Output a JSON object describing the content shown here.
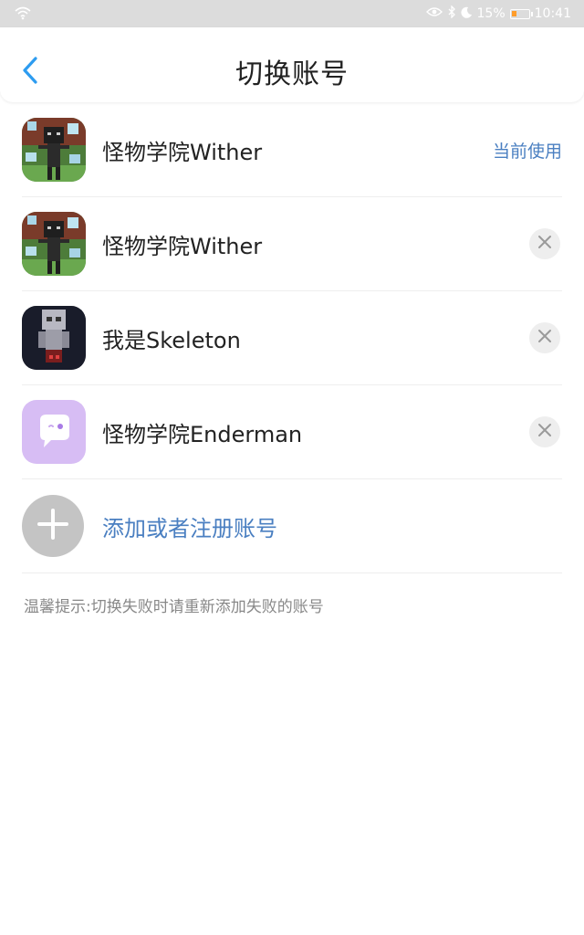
{
  "status_bar": {
    "battery_percent": "15%",
    "time": "10:41",
    "icons": [
      "wifi-icon",
      "eye-icon",
      "bluetooth-icon",
      "moon-icon",
      "battery-icon"
    ]
  },
  "header": {
    "title": "切换账号",
    "back_icon": "chevron-left-icon"
  },
  "accounts": [
    {
      "name": "怪物学院Wither",
      "status": "当前使用",
      "avatar": "wither"
    },
    {
      "name": "怪物学院Wither",
      "status": "",
      "avatar": "wither"
    },
    {
      "name": "我是Skeleton",
      "status": "",
      "avatar": "skeleton"
    },
    {
      "name": "怪物学院Enderman",
      "status": "",
      "avatar": "chat-bubble"
    }
  ],
  "add_account": {
    "label": "添加或者注册账号"
  },
  "tip": "温馨提示:切换失败时请重新添加失败的账号",
  "colors": {
    "accent": "#4a7fc1",
    "back_arrow": "#2d9cf0",
    "status_bar_bg": "#dcdcdc",
    "enderman_avatar_bg": "#d7bdf4"
  }
}
